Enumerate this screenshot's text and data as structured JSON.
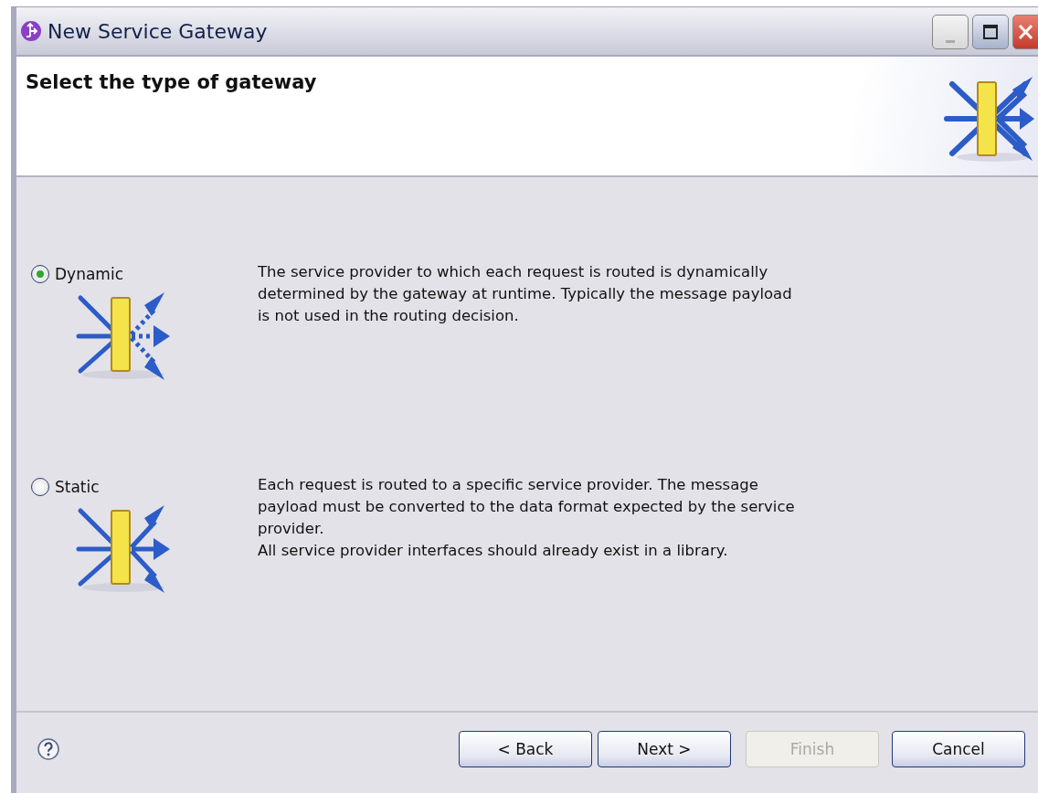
{
  "window": {
    "title": "New Service Gateway"
  },
  "header": {
    "title": "Select the type of gateway"
  },
  "options": [
    {
      "label": "Dynamic",
      "selected": true,
      "kind": "dynamic",
      "description": [
        "The service provider to which each request is routed is dynamically determined by the gateway at runtime. Typically the message payload is not used in the routing decision."
      ]
    },
    {
      "label": "Static",
      "selected": false,
      "kind": "static",
      "description": [
        "Each request is routed to a specific service provider. The message payload must be converted to the data format expected by the service provider.",
        "All service provider interfaces should already exist in a library."
      ]
    }
  ],
  "buttons": [
    {
      "label": "< Back",
      "disabled": false
    },
    {
      "label": "Next >",
      "disabled": false
    },
    {
      "label": "Finish",
      "disabled": true
    },
    {
      "label": "Cancel",
      "disabled": false
    }
  ]
}
